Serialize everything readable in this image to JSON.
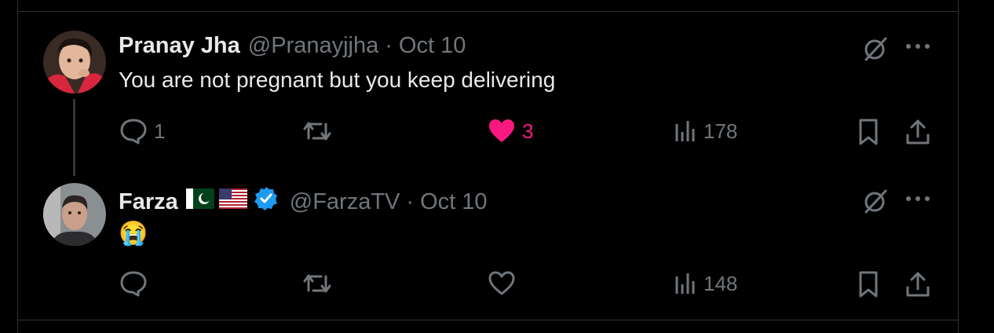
{
  "tweets": [
    {
      "name": "Pranay Jha",
      "handle": "@Pranayjjha",
      "separator": "·",
      "date": "Oct 10",
      "text": "You are not pregnant but you keep delivering",
      "replies": "1",
      "retweets": "",
      "likes": "3",
      "views": "178",
      "liked": true
    },
    {
      "name": "Farza",
      "handle": "@FarzaTV",
      "separator": "·",
      "date": "Oct 10",
      "text": "😭",
      "replies": "",
      "retweets": "",
      "likes": "",
      "views": "148",
      "liked": false,
      "verified": true
    }
  ],
  "colors": {
    "background": "#000000",
    "text": "#e7e9ea",
    "muted": "#71767b",
    "like": "#f91880",
    "verified": "#1d9bf0",
    "border": "#2f3336"
  }
}
